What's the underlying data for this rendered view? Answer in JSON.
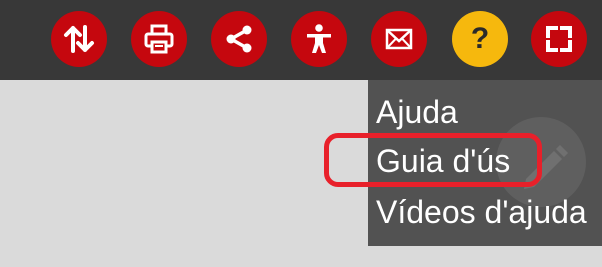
{
  "colors": {
    "toolbar_bg": "#383838",
    "button_red": "#c5070e",
    "button_help_yellow": "#f6b80d",
    "menu_bg": "#525252",
    "content_bg": "#dadada",
    "highlight_red": "#e8202a"
  },
  "toolbar": {
    "buttons": [
      {
        "icon": "sort-arrows-icon",
        "color": "#c5070e"
      },
      {
        "icon": "print-icon",
        "color": "#c5070e"
      },
      {
        "icon": "share-icon",
        "color": "#c5070e"
      },
      {
        "icon": "accessibility-icon",
        "color": "#c5070e"
      },
      {
        "icon": "mail-icon",
        "color": "#c5070e"
      },
      {
        "icon": "help-icon",
        "color": "#f6b80d",
        "label": "?"
      },
      {
        "icon": "fullscreen-icon",
        "color": "#c5070e"
      }
    ]
  },
  "help_menu": {
    "items": [
      {
        "label": "Ajuda"
      },
      {
        "label": "Guia d'ús"
      },
      {
        "label": "Vídeos d'ajuda"
      }
    ],
    "watermark_icon": "pencil-icon",
    "highlighted_item": "Guia d'ús"
  }
}
